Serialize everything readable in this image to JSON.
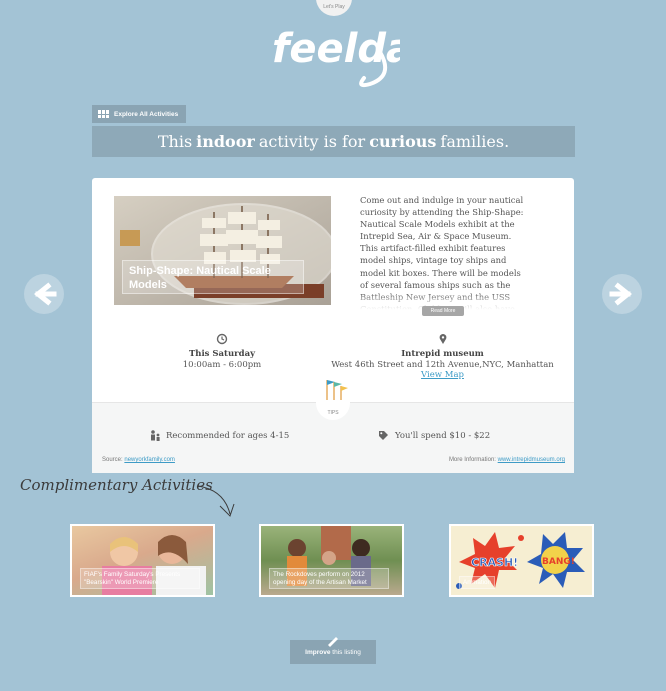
{
  "header": {
    "tab_label": "Let's Play",
    "logo_text": "feelday"
  },
  "toolbar": {
    "explore_label": "Explore All Activities"
  },
  "tagline": {
    "prefix": "This",
    "type": "indoor",
    "middle": "activity is for",
    "audience": "curious",
    "suffix": "families."
  },
  "activity": {
    "title": "Ship-Shape: Nautical Scale Models",
    "description": "Come out and indulge in your nautical curiosity by attending the Ship-Shape: Nautical Scale Models exhibit at the Intrepid Sea, Air & Space Museum. This artifact-filled exhibit features model ships, vintage toy ships and model kit boxes. There will be models of several famous ships such as the Battleship New Jersey and the USS Constitution. Children will also have the opportunity to explore a modeler's workbench to get a better",
    "read_more_label": "Read More",
    "when_title": "This Saturday",
    "when_hours": "10:00am - 6:00pm",
    "where_title": "Intrepid museum",
    "where_address": "West 46th Street and 12th Avenue,NYC, Manhattan",
    "view_map_label": "View Map"
  },
  "tips": {
    "badge_label": "TIPS",
    "age_text": "Recommended for ages 4-15",
    "cost_text": "You'll spend $10 - $22",
    "source_label": "Source:",
    "source_link": "newyorkfamily.com",
    "more_info_label": "More Information:",
    "more_info_link": "www.intrepidmuseum.org"
  },
  "complimentary": {
    "heading": "Complimentary Activities",
    "items": [
      {
        "caption": "FIAF's Family Saturday's Presents \"Bearskin\" World Premiere"
      },
      {
        "caption": "The Rockdoves perform on 2012 opening day of the Artisan Market"
      },
      {
        "caption": "Animation"
      }
    ]
  },
  "footer": {
    "improve_bold": "Improve",
    "improve_rest": "this listing"
  },
  "colors": {
    "background": "#a3c3d5",
    "bar": "#8ea9b8",
    "link": "#3d9bc6"
  }
}
